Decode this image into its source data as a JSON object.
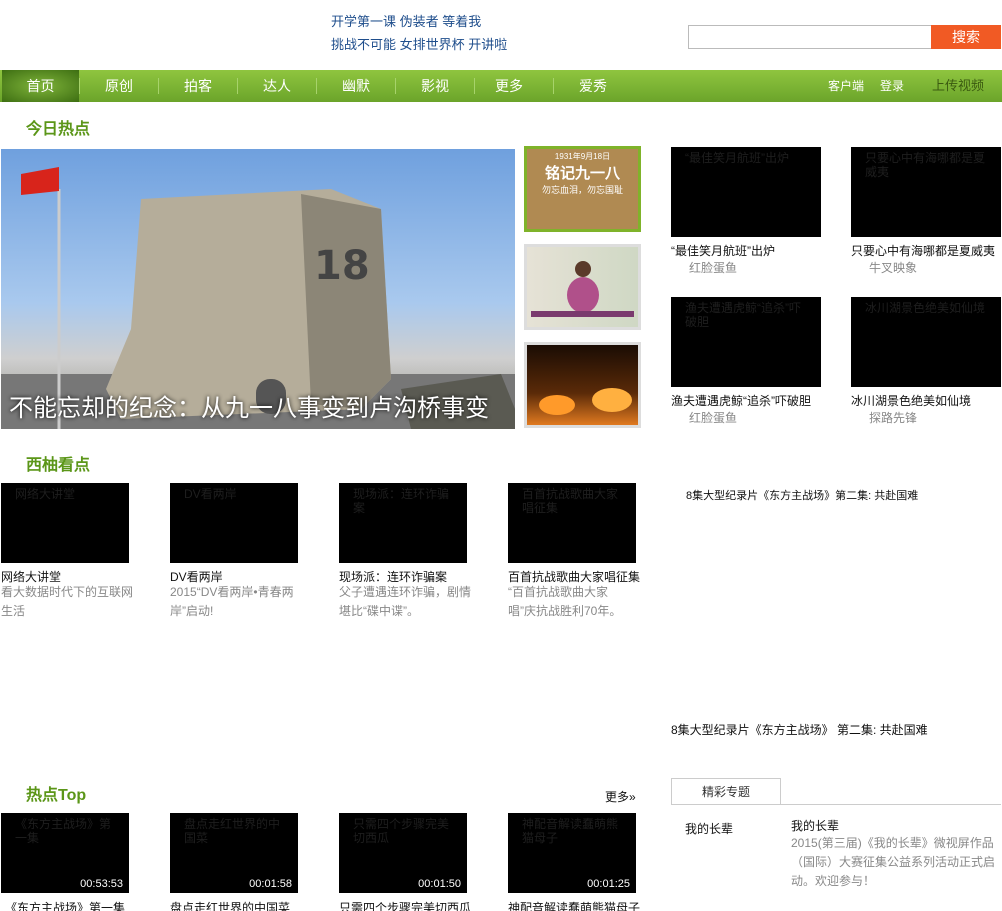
{
  "header": {
    "links_row1": [
      "开学第一课",
      "伪装者",
      "等着我"
    ],
    "links_row2": [
      "挑战不可能",
      "女排世界杯",
      "开讲啦"
    ],
    "search_placeholder": "",
    "search_button": "搜索"
  },
  "nav": {
    "items": [
      "首页",
      "原创",
      "拍客",
      "达人",
      "幽默",
      "影视",
      "更多",
      "爱秀"
    ],
    "active": "首页",
    "right": {
      "client": "客户端",
      "login": "登录",
      "upload": "上传视频"
    }
  },
  "today_hot": {
    "title": "今日热点",
    "hero_caption": "不能忘却的纪念：从九一八事变到卢沟桥事变",
    "side_thumb_1": {
      "line1": "1931年9月18日",
      "line2": "铭记九一八",
      "line3": "勿忘血泪，勿忘国耻"
    },
    "grid": [
      {
        "title": "“最佳笑月航班”出炉",
        "source": "红脸蛋鱼"
      },
      {
        "title": "只要心中有海哪都是夏威夷",
        "source": "牛叉映象"
      },
      {
        "title": "渔夫遭遇虎鲸“追杀”吓破胆",
        "source": "红脸蛋鱼"
      },
      {
        "title": "冰川湖景色绝美如仙境",
        "source": "探路先锋"
      }
    ]
  },
  "xiyou": {
    "title": "西柚看点",
    "items": [
      {
        "title": "网络大讲堂",
        "desc": "看大数据时代下的互联网生活"
      },
      {
        "title": "DV看两岸",
        "desc": "2015“DV看两岸•青春两岸”启动!"
      },
      {
        "title": "现场派：连环诈骗案",
        "desc": "父子遭遇连环诈骗，剧情堪比“碟中谍”。"
      },
      {
        "title": "百首抗战歌曲大家唱征集",
        "desc": "“百首抗战歌曲大家唱”庆抗战胜利70年。"
      }
    ]
  },
  "documentary": {
    "line1": "8集大型纪录片《东方主战场》第二集: 共赴国难",
    "line2": "8集大型纪录片《东方主战场》 第二集: 共赴国难"
  },
  "hot_top": {
    "title": "热点Top",
    "more": "更多»",
    "items": [
      {
        "title": "《东方主战场》第一集",
        "duration": "00:53:53"
      },
      {
        "title": "盘点走红世界的中国菜",
        "duration": "00:01:58"
      },
      {
        "title": "只需四个步骤完美切西瓜",
        "duration": "00:01:50"
      },
      {
        "title": "神配音解读蠢萌熊猫母子",
        "duration": "00:01:25"
      }
    ]
  },
  "special": {
    "tab": "精彩专题",
    "left_label": "我的长辈",
    "title": "我的长辈",
    "desc": "2015(第三届)《我的长辈》微视屏作品（国际）大赛征集公益系列活动正式启动。欢迎参与！"
  }
}
